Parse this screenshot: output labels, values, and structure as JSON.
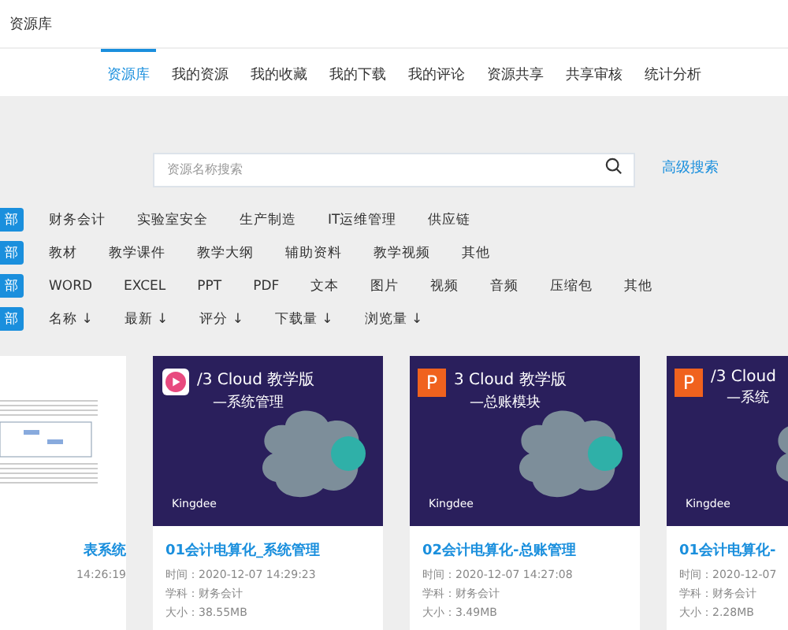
{
  "header": {
    "title": "资源库"
  },
  "nav": [
    {
      "label": "资源库",
      "selected": true
    },
    {
      "label": "我的资源",
      "selected": false
    },
    {
      "label": "我的收藏",
      "selected": false
    },
    {
      "label": "我的下载",
      "selected": false
    },
    {
      "label": "我的评论",
      "selected": false
    },
    {
      "label": "资源共享",
      "selected": false
    },
    {
      "label": "共享审核",
      "selected": false
    },
    {
      "label": "统计分析",
      "selected": false
    }
  ],
  "search": {
    "placeholder": "资源名称搜索",
    "advanced": "高级搜索"
  },
  "filters": [
    {
      "items": [
        {
          "label": "部",
          "selected": true
        },
        {
          "label": "财务会计",
          "selected": false
        },
        {
          "label": "实验室安全",
          "selected": false
        },
        {
          "label": "生产制造",
          "selected": false
        },
        {
          "label": "IT运维管理",
          "selected": false
        },
        {
          "label": "供应链",
          "selected": false
        }
      ]
    },
    {
      "items": [
        {
          "label": "部",
          "selected": true
        },
        {
          "label": "教材",
          "selected": false
        },
        {
          "label": "教学课件",
          "selected": false
        },
        {
          "label": "教学大纲",
          "selected": false
        },
        {
          "label": "辅助资料",
          "selected": false
        },
        {
          "label": "教学视频",
          "selected": false
        },
        {
          "label": "其他",
          "selected": false
        }
      ]
    },
    {
      "items": [
        {
          "label": "部",
          "selected": true
        },
        {
          "label": "WORD",
          "selected": false
        },
        {
          "label": "EXCEL",
          "selected": false
        },
        {
          "label": "PPT",
          "selected": false
        },
        {
          "label": "PDF",
          "selected": false
        },
        {
          "label": "文本",
          "selected": false
        },
        {
          "label": "图片",
          "selected": false
        },
        {
          "label": "视频",
          "selected": false
        },
        {
          "label": "音频",
          "selected": false
        },
        {
          "label": "压缩包",
          "selected": false
        },
        {
          "label": "其他",
          "selected": false
        }
      ]
    },
    {
      "items": [
        {
          "label": "部",
          "selected": true
        },
        {
          "label": "名称 ↓",
          "selected": false
        },
        {
          "label": "最新 ↓",
          "selected": false
        },
        {
          "label": "评分 ↓",
          "selected": false
        },
        {
          "label": "下载量 ↓",
          "selected": false
        },
        {
          "label": "浏览量 ↓",
          "selected": false
        }
      ]
    }
  ],
  "cards": [
    {
      "kind": "document",
      "title": "表系统",
      "meta": [
        "14:26:19"
      ]
    },
    {
      "kind": "video",
      "slide_lines": [
        "/3 Cloud 教学版",
        "—系统管理"
      ],
      "logo": "Kingdee",
      "title": "01会计电算化_系统管理",
      "meta": [
        "时间：2020-12-07 14:29:23",
        "学科：财务会计",
        "大小：38.55MB"
      ]
    },
    {
      "kind": "ppt",
      "badge": "P",
      "slide_lines": [
        "3 Cloud 教学版",
        "—总账模块"
      ],
      "logo": "Kingdee",
      "title": "02会计电算化-总账管理",
      "meta": [
        "时间：2020-12-07 14:27:08",
        "学科：财务会计",
        "大小：3.49MB"
      ]
    },
    {
      "kind": "ppt",
      "badge": "P",
      "slide_lines": [
        "/3 Cloud",
        "—系统"
      ],
      "logo": "Kingdee",
      "title": "01会计电算化-",
      "meta": [
        "时间：2020-12-07",
        "学科：财务会计",
        "大小：2.28MB"
      ]
    }
  ]
}
